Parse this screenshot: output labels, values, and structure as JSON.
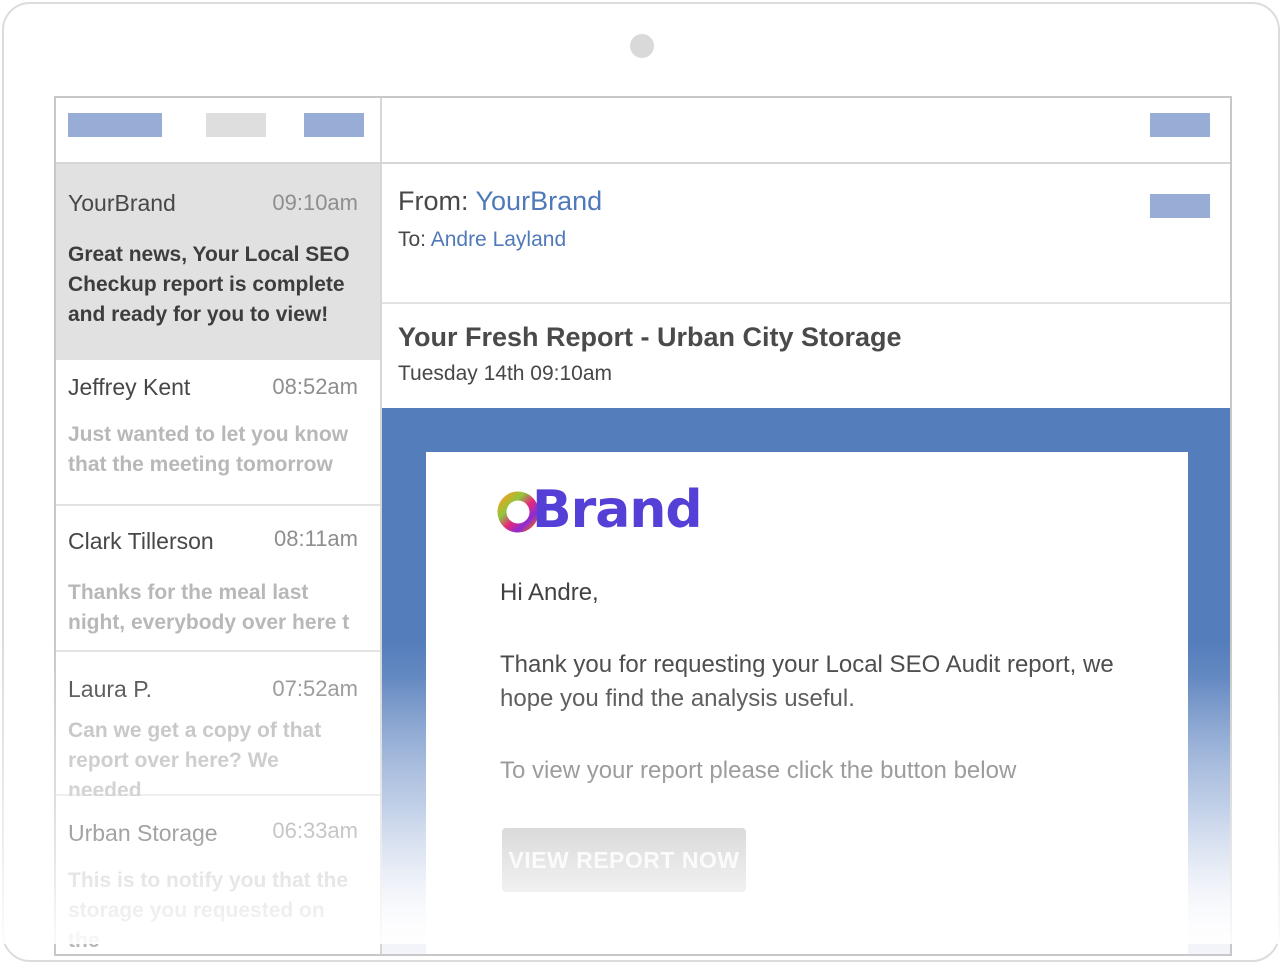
{
  "toolbar": {
    "left_buttons": [
      "blue",
      "grey",
      "blue"
    ],
    "right_button": "blue"
  },
  "inbox": {
    "messages": [
      {
        "sender": "YourBrand",
        "time": "09:10am",
        "preview_lines": [
          "Great news, Your Local SEO",
          "Checkup report is complete",
          "and ready for you to view!"
        ],
        "selected": true
      },
      {
        "sender": "Jeffrey Kent",
        "time": "08:52am",
        "preview_lines": [
          "Just wanted to let you know",
          "that the meeting tomorrow"
        ],
        "selected": false
      },
      {
        "sender": "Clark Tillerson",
        "time": "08:11am",
        "preview_lines": [
          "Thanks for the meal last",
          "night, everybody over here t"
        ],
        "selected": false
      },
      {
        "sender": "Laura P.",
        "time": "07:52am",
        "preview_lines": [
          "Can we get a copy of that",
          "report over here? We needed"
        ],
        "selected": false
      },
      {
        "sender": "Urban Storage",
        "time": "06:33am",
        "preview_lines": [
          "This is to notify you that the",
          "storage you requested on the"
        ],
        "selected": false
      }
    ]
  },
  "email": {
    "from_label": "From: ",
    "from_name": "YourBrand",
    "to_label": "To: ",
    "to_name": "Andre Layland",
    "subject": "Your Fresh Report - Urban City Storage",
    "date": "Tuesday 14th 09:10am",
    "logo_text": "Brand",
    "greeting": "Hi Andre,",
    "paragraph1_lines": [
      "Thank you for requesting your Local SEO Audit report, we",
      "hope you find the analysis useful."
    ],
    "paragraph2": "To view your report please click the button below",
    "cta_label": "VIEW REPORT NOW"
  },
  "colors": {
    "accent_blue": "#547dbb",
    "link_blue": "#5079b9",
    "logo_purple": "#5440d6",
    "toolbar_blue": "#97add6"
  }
}
